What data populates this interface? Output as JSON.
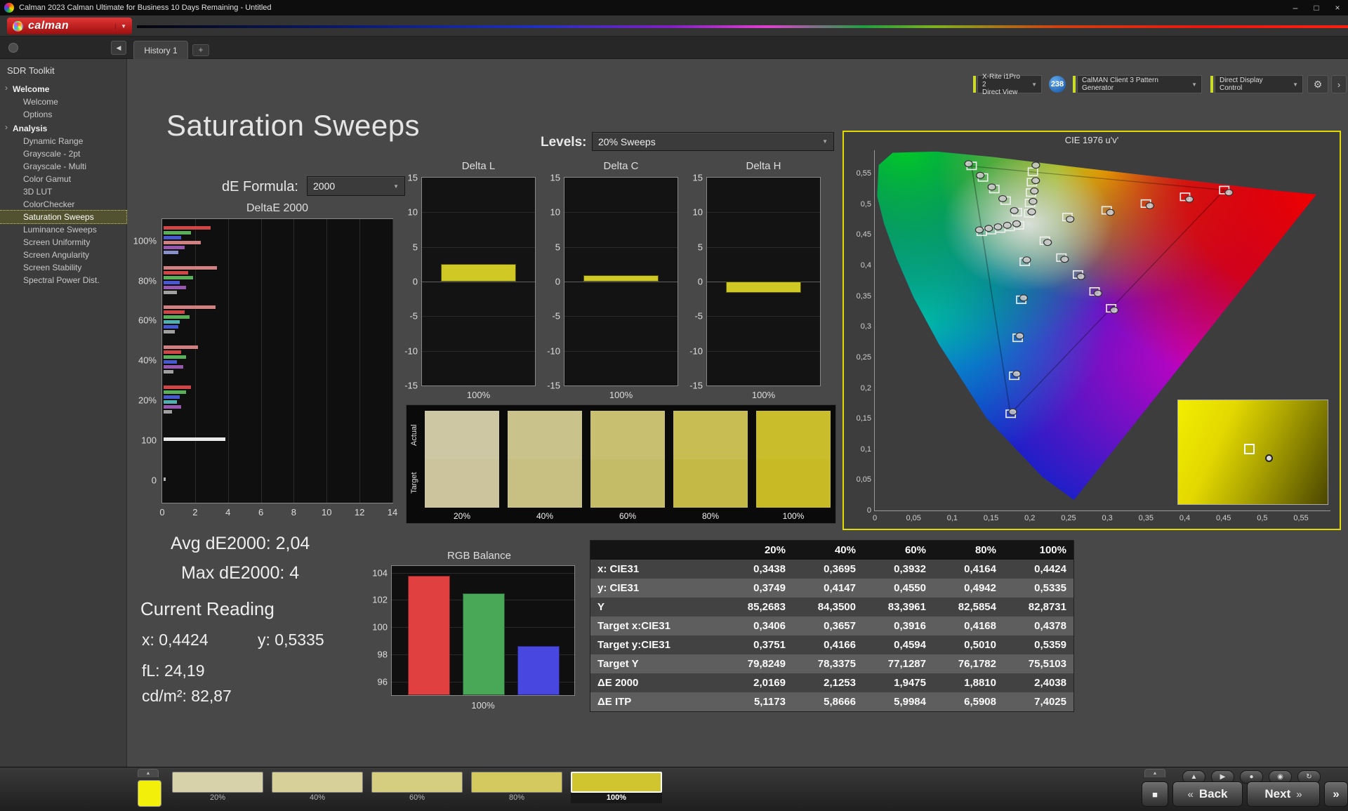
{
  "titlebar": {
    "title": "Calman 2023 Calman Ultimate for Business 10 Days Remaining  - Untitled",
    "minimize": "–",
    "maximize": "□",
    "close": "×"
  },
  "logobar": {
    "brand": "calman"
  },
  "icons": {
    "chevron_down": "▼",
    "collapse_left": "◀",
    "gear": "⚙",
    "more": "›"
  },
  "tabbar": {
    "history_tab": "History 1",
    "add_tab": "+",
    "meter_badge": "238",
    "devices": [
      {
        "line1": "X-Rite i1Pro 2",
        "line2": "Direct View"
      },
      {
        "line1": "CalMAN Client 3 Pattern Generator",
        "line2": ""
      },
      {
        "line1": "Direct Display Control",
        "line2": ""
      }
    ]
  },
  "sidebar": {
    "title": "SDR Toolkit",
    "sections": [
      {
        "label": "Welcome",
        "items": [
          {
            "label": "Welcome"
          },
          {
            "label": "Options"
          }
        ]
      },
      {
        "label": "Analysis",
        "items": [
          {
            "label": "Dynamic Range"
          },
          {
            "label": "Grayscale - 2pt"
          },
          {
            "label": "Grayscale - Multi"
          },
          {
            "label": "Color Gamut"
          },
          {
            "label": "3D LUT"
          },
          {
            "label": "ColorChecker"
          },
          {
            "label": "Saturation Sweeps",
            "selected": true
          },
          {
            "label": "Luminance Sweeps"
          },
          {
            "label": "Screen Uniformity"
          },
          {
            "label": "Screen Angularity"
          },
          {
            "label": "Screen Stability"
          },
          {
            "label": "Spectral Power Dist."
          }
        ]
      }
    ]
  },
  "main": {
    "title": "Saturation Sweeps",
    "de_formula": {
      "label": "dE Formula:",
      "value": "2000"
    },
    "levels": {
      "label": "Levels:",
      "value": "20% Sweeps"
    },
    "stats": {
      "avg": "Avg dE2000: 2,04",
      "max": "Max dE2000: 4",
      "current_reading": "Current Reading",
      "x": "x: 0,4424",
      "y": "y: 0,5335",
      "fl": "fL: 24,19",
      "cd": "cd/m²: 82,87"
    }
  },
  "charts": {
    "bar_color": "#cfc825",
    "deltae": {
      "type": "bar",
      "title": "DeltaE 2000",
      "xticks": [
        0,
        2,
        4,
        6,
        8,
        10,
        12,
        14
      ],
      "xmax": 14,
      "groups": [
        {
          "label": "100%",
          "bars": [
            [
              "#d04545",
              2.9
            ],
            [
              "#58b058",
              1.7
            ],
            [
              "#4858d0",
              1.1
            ],
            [
              "#d08080",
              2.3
            ],
            [
              "#9858b0",
              1.3
            ],
            [
              "#8890cc",
              0.9
            ]
          ]
        },
        {
          "label": "80%",
          "bars": [
            [
              "#d08080",
              3.3
            ],
            [
              "#d04545",
              1.5
            ],
            [
              "#58b058",
              1.8
            ],
            [
              "#4858d0",
              1.0
            ],
            [
              "#9858b0",
              1.4
            ],
            [
              "#a0a0a0",
              0.8
            ]
          ]
        },
        {
          "label": "60%",
          "bars": [
            [
              "#d08080",
              3.2
            ],
            [
              "#d04545",
              1.3
            ],
            [
              "#58b058",
              1.6
            ],
            [
              "#50b0b0",
              1.0
            ],
            [
              "#4858d0",
              0.9
            ],
            [
              "#a0a0a0",
              0.7
            ]
          ]
        },
        {
          "label": "40%",
          "bars": [
            [
              "#d08080",
              2.1
            ],
            [
              "#d04545",
              1.1
            ],
            [
              "#58b058",
              1.4
            ],
            [
              "#4858d0",
              0.8
            ],
            [
              "#9858b0",
              1.2
            ],
            [
              "#a0a0a0",
              0.6
            ]
          ]
        },
        {
          "label": "20%",
          "bars": [
            [
              "#d04545",
              1.7
            ],
            [
              "#58b058",
              1.4
            ],
            [
              "#4858d0",
              1.0
            ],
            [
              "#50b0b0",
              0.8
            ],
            [
              "#9858b0",
              1.1
            ],
            [
              "#a0a0a0",
              0.5
            ]
          ]
        },
        {
          "label": "100",
          "bars": [
            [
              "#e8e8e8",
              3.8
            ]
          ]
        },
        {
          "label": "0",
          "bars": [
            [
              "#b0b0b0",
              0.15
            ]
          ]
        }
      ]
    },
    "delta_small": [
      {
        "type": "bar",
        "title": "Delta L",
        "value": 2.5,
        "range": 15,
        "xlabel": "100%"
      },
      {
        "type": "bar",
        "title": "Delta C",
        "value": 0.9,
        "range": 15,
        "xlabel": "100%"
      },
      {
        "type": "bar",
        "title": "Delta H",
        "value": -1.6,
        "range": 15,
        "xlabel": "100%"
      }
    ],
    "rgb_balance": {
      "type": "bar",
      "title": "RGB Balance",
      "yticks": [
        96,
        98,
        100,
        102,
        104
      ],
      "ymin": 95,
      "ymax": 104.5,
      "xlabel": "100%",
      "bars": [
        [
          "#e04040",
          103.8
        ],
        [
          "#48a858",
          102.5
        ],
        [
          "#4848e0",
          98.6
        ]
      ]
    },
    "saturation_swatches": {
      "row_labels": [
        "Actual",
        "Target"
      ],
      "levels": [
        "20%",
        "40%",
        "60%",
        "80%",
        "100%"
      ],
      "actual": [
        "#cdc7a4",
        "#cac28b",
        "#c8bf71",
        "#c7bd52",
        "#c9bd2b"
      ],
      "target": [
        "#cbc49c",
        "#c8c083",
        "#c5bc67",
        "#c4b947",
        "#c7ba25"
      ]
    },
    "cie": {
      "type": "scatter",
      "title": "CIE 1976 u'v'",
      "axis_max": 0.588,
      "tick_step": 0.05,
      "xlabels": [
        "0",
        "0,05",
        "0,1",
        "0,15",
        "0,2",
        "0,25",
        "0,3",
        "0,35",
        "0,4",
        "0,45",
        "0,5",
        "0,55"
      ],
      "ylabels": [
        "0",
        "0,05",
        "0,1",
        "0,15",
        "0,2",
        "0,25",
        "0,3",
        "0,35",
        "0,4",
        "0,45",
        "0,5",
        "0,55"
      ],
      "squares": [
        [
          0.2486,
          0.479
        ],
        [
          0.2992,
          0.49
        ],
        [
          0.3498,
          0.501
        ],
        [
          0.4004,
          0.512
        ],
        [
          0.451,
          0.523
        ],
        [
          0.1834,
          0.4869
        ],
        [
          0.1688,
          0.5058
        ],
        [
          0.1542,
          0.5247
        ],
        [
          0.1396,
          0.5436
        ],
        [
          0.125,
          0.5625
        ],
        [
          0.1935,
          0.406
        ],
        [
          0.189,
          0.344
        ],
        [
          0.1844,
          0.2819
        ],
        [
          0.1799,
          0.2199
        ],
        [
          0.1754,
          0.1579
        ],
        [
          0.186,
          0.4654
        ],
        [
          0.174,
          0.4628
        ],
        [
          0.162,
          0.4602
        ],
        [
          0.15,
          0.4576
        ],
        [
          0.138,
          0.455
        ],
        [
          0.2194,
          0.4404
        ],
        [
          0.2408,
          0.4128
        ],
        [
          0.2622,
          0.3852
        ],
        [
          0.2836,
          0.3576
        ],
        [
          0.305,
          0.33
        ],
        [
          0.1992,
          0.485
        ],
        [
          0.2004,
          0.502
        ],
        [
          0.2016,
          0.519
        ],
        [
          0.2028,
          0.536
        ],
        [
          0.204,
          0.553
        ]
      ],
      "circles": [
        [
          0.252,
          0.4755
        ],
        [
          0.304,
          0.4865
        ],
        [
          0.355,
          0.4975
        ],
        [
          0.406,
          0.508
        ],
        [
          0.457,
          0.519
        ],
        [
          0.18,
          0.4895
        ],
        [
          0.165,
          0.509
        ],
        [
          0.151,
          0.528
        ],
        [
          0.136,
          0.547
        ],
        [
          0.121,
          0.566
        ],
        [
          0.196,
          0.409
        ],
        [
          0.192,
          0.347
        ],
        [
          0.187,
          0.285
        ],
        [
          0.183,
          0.223
        ],
        [
          0.178,
          0.161
        ],
        [
          0.183,
          0.468
        ],
        [
          0.171,
          0.4655
        ],
        [
          0.159,
          0.463
        ],
        [
          0.147,
          0.4605
        ],
        [
          0.135,
          0.458
        ],
        [
          0.223,
          0.4375
        ],
        [
          0.245,
          0.41
        ],
        [
          0.266,
          0.382
        ],
        [
          0.288,
          0.3545
        ],
        [
          0.309,
          0.327
        ],
        [
          0.2025,
          0.4875
        ],
        [
          0.2042,
          0.5045
        ],
        [
          0.2059,
          0.5215
        ],
        [
          0.2076,
          0.5385
        ],
        [
          0.2078,
          0.5637
        ]
      ],
      "inset": {
        "square": [
          44,
          42
        ],
        "circle": [
          58,
          52
        ]
      }
    }
  },
  "table": {
    "columns": [
      "20%",
      "40%",
      "60%",
      "80%",
      "100%"
    ],
    "rows": [
      {
        "label": "x: CIE31",
        "values": [
          "0,3438",
          "0,3695",
          "0,3932",
          "0,4164",
          "0,4424"
        ]
      },
      {
        "label": "y: CIE31",
        "values": [
          "0,3749",
          "0,4147",
          "0,4550",
          "0,4942",
          "0,5335"
        ]
      },
      {
        "label": "Y",
        "values": [
          "85,2683",
          "84,3500",
          "83,3961",
          "82,5854",
          "82,8731"
        ]
      },
      {
        "label": "Target x:CIE31",
        "values": [
          "0,3406",
          "0,3657",
          "0,3916",
          "0,4168",
          "0,4378"
        ]
      },
      {
        "label": "Target y:CIE31",
        "values": [
          "0,3751",
          "0,4166",
          "0,4594",
          "0,5010",
          "0,5359"
        ]
      },
      {
        "label": "Target Y",
        "values": [
          "79,8249",
          "78,3375",
          "77,1287",
          "76,1782",
          "75,5103"
        ]
      },
      {
        "label": "ΔE 2000",
        "values": [
          "2,0169",
          "2,1253",
          "1,9475",
          "1,8810",
          "2,4038"
        ]
      },
      {
        "label": "ΔE ITP",
        "values": [
          "5,1173",
          "5,8666",
          "5,9984",
          "6,5908",
          "7,4025"
        ]
      }
    ]
  },
  "bottombar": {
    "panel_toggle_glyph": "▲",
    "pattern_color": "#f2ef0a",
    "swatches": [
      {
        "label": "20%",
        "color": "#d8d2ab"
      },
      {
        "label": "40%",
        "color": "#d7d099"
      },
      {
        "label": "60%",
        "color": "#d5cd80"
      },
      {
        "label": "80%",
        "color": "#d3c95f"
      },
      {
        "label": "100%",
        "color": "#d0c52f",
        "selected": true
      }
    ],
    "transport": {
      "icons": [
        {
          "name": "eject-icon",
          "glyph": "▲"
        },
        {
          "name": "play-icon",
          "glyph": "▶"
        },
        {
          "name": "record-icon",
          "glyph": "●"
        },
        {
          "name": "preview-icon",
          "glyph": "◉"
        },
        {
          "name": "refresh-icon",
          "glyph": "↻"
        }
      ],
      "stop_glyph": "■",
      "back_arrow": "«",
      "back_label": "Back",
      "next_label": "Next",
      "next_arrow": "»",
      "edge_glyph": "»"
    }
  }
}
